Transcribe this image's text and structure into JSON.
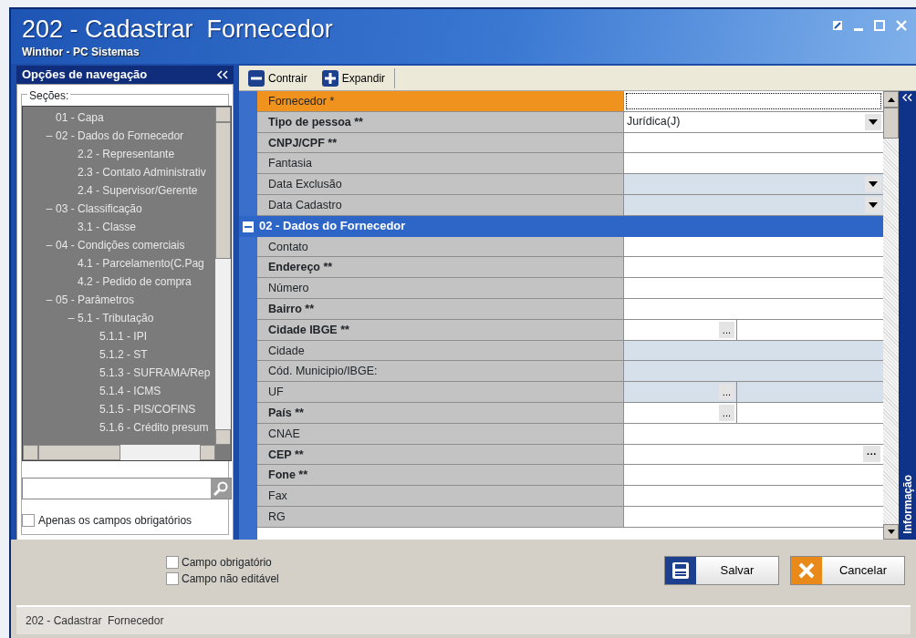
{
  "window": {
    "title": "202 - Cadastrar  Fornecedor",
    "subtitle": "Winthor - PC Sistemas"
  },
  "navigation": {
    "title": "Opções de navegação",
    "sections_label": "Seções:",
    "tree": [
      {
        "label": "01 - Capa"
      },
      {
        "label": "02 - Dados do Fornecedor",
        "toggle": "–",
        "children": [
          {
            "label": "2.2 - Representante"
          },
          {
            "label": "2.3 - Contato Administrativ"
          },
          {
            "label": "2.4 - Supervisor/Gerente"
          }
        ]
      },
      {
        "label": "03 - Classificação",
        "toggle": "–",
        "children": [
          {
            "label": "3.1 - Classe"
          }
        ]
      },
      {
        "label": "04 - Condições comerciais",
        "toggle": "–",
        "children": [
          {
            "label": "4.1 - Parcelamento(C.Pag"
          },
          {
            "label": "4.2 - Pedido de compra"
          }
        ]
      },
      {
        "label": "05 - Parâmetros",
        "toggle": "–",
        "children": [
          {
            "label": "5.1 - Tributação",
            "toggle": "–",
            "children": [
              {
                "label": "5.1.1 - IPI"
              },
              {
                "label": "5.1.2 - ST"
              },
              {
                "label": "5.1.3 - SUFRAMA/Rep"
              },
              {
                "label": "5.1.4 - ICMS"
              },
              {
                "label": "5.1.5 - PIS/COFINS"
              },
              {
                "label": "5.1.6 - Crédito presum"
              }
            ]
          }
        ]
      }
    ],
    "required_only": {
      "label": "Apenas os campos obrigatórios",
      "checked": false
    }
  },
  "toolbar": [
    {
      "label": "Contrair",
      "kind": "collapse"
    },
    {
      "label": "Expandir",
      "kind": "expand"
    }
  ],
  "grid": {
    "rows": [
      {
        "kind": "text",
        "label": "Fornecedor *",
        "bold": false,
        "selected": true,
        "editable": true
      },
      {
        "kind": "dropdown",
        "label": "Tipo de pessoa **",
        "bold": true,
        "selected": false,
        "editable": true,
        "value": "Jurídica(J)"
      },
      {
        "kind": "text",
        "label": "CNPJ/CPF **",
        "bold": true,
        "selected": false,
        "editable": true
      },
      {
        "kind": "text",
        "label": "Fantasia",
        "bold": false,
        "selected": false,
        "editable": true
      },
      {
        "kind": "dropdown",
        "label": "Data Exclusão",
        "bold": false,
        "selected": false,
        "editable": false
      },
      {
        "kind": "dropdown",
        "label": "Data Cadastro",
        "bold": false,
        "selected": false,
        "editable": false
      },
      {
        "kind": "section",
        "label": "02 - Dados do Fornecedor",
        "expanded": true
      },
      {
        "kind": "text",
        "label": "Contato",
        "bold": false,
        "selected": false,
        "editable": true
      },
      {
        "kind": "text",
        "label": "Endereço **",
        "bold": true,
        "selected": false,
        "editable": true
      },
      {
        "kind": "text",
        "label": "Número",
        "bold": false,
        "selected": false,
        "editable": true
      },
      {
        "kind": "text",
        "label": "Bairro **",
        "bold": true,
        "selected": false,
        "editable": true
      },
      {
        "kind": "lookup",
        "label": "Cidade IBGE **",
        "bold": true,
        "selected": false,
        "editable": true,
        "button": "..."
      },
      {
        "kind": "text",
        "label": "Cidade",
        "bold": false,
        "selected": false,
        "editable": false
      },
      {
        "kind": "text",
        "label": "Cód. Municipio/IBGE:",
        "bold": false,
        "selected": false,
        "editable": false
      },
      {
        "kind": "lookup",
        "label": "UF",
        "bold": false,
        "selected": false,
        "editable": false,
        "button": "..."
      },
      {
        "kind": "lookup",
        "label": "País **",
        "bold": true,
        "selected": false,
        "editable": true,
        "button": "..."
      },
      {
        "kind": "text",
        "label": "CNAE",
        "bold": false,
        "selected": false,
        "editable": true
      },
      {
        "kind": "ellipsis",
        "label": "CEP **",
        "bold": true,
        "selected": false,
        "editable": true,
        "button": "···"
      },
      {
        "kind": "text",
        "label": "Fone **",
        "bold": true,
        "selected": false,
        "editable": true
      },
      {
        "kind": "text",
        "label": "Fax",
        "bold": false,
        "selected": false,
        "editable": true
      },
      {
        "kind": "text",
        "label": "RG",
        "bold": false,
        "selected": false,
        "editable": true
      }
    ]
  },
  "side_panel": {
    "title": "Informação"
  },
  "legend": [
    {
      "label": "Campo obrigatório"
    },
    {
      "label": "Campo não editável"
    }
  ],
  "buttons": [
    {
      "label": "Salvar",
      "kind": "save"
    },
    {
      "label": "Cancelar",
      "kind": "cancel"
    }
  ],
  "status_bar": "202 - Cadastrar  Fornecedor"
}
